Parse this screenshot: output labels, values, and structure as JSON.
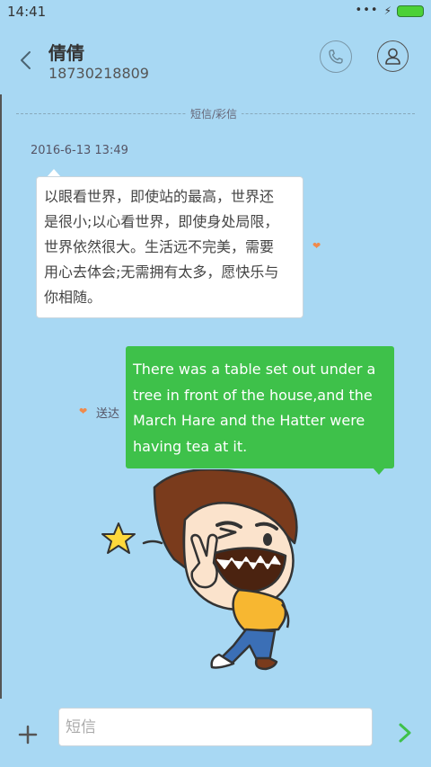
{
  "status_bar": {
    "time": "14:41",
    "icons": [
      "more-dots-icon",
      "charging-bolt-icon",
      "battery-icon"
    ]
  },
  "header": {
    "contact_name": "倩倩",
    "contact_number": "18730218809",
    "icons": {
      "back": "chevron-left-icon",
      "call": "phone-icon",
      "profile": "person-icon"
    }
  },
  "conversation": {
    "channel_label": "短信/彩信",
    "timestamp": "2016-6-13 13:49",
    "incoming": {
      "lines": [
        "以眼看世界，即使站的最高，世界还",
        "是很小;以心看世界，即使身处局限，",
        "世界依然很大。生活远不完美，需要",
        "用心去体会;无需拥有太多，愿快乐与",
        "你相随。"
      ]
    },
    "outgoing": {
      "lines": [
        "There was a table set out under a",
        "tree in front of the house,and the",
        "March Hare and the Hatter were",
        "having tea at it."
      ],
      "status": "送达"
    }
  },
  "composer": {
    "placeholder": "短信",
    "value": ""
  },
  "colors": {
    "background": "#a8d8f3",
    "outgoing_bubble": "#3ec14a",
    "incoming_bubble": "#ffffff",
    "heart": "#f08a4b",
    "send_arrow": "#3ec14a"
  }
}
